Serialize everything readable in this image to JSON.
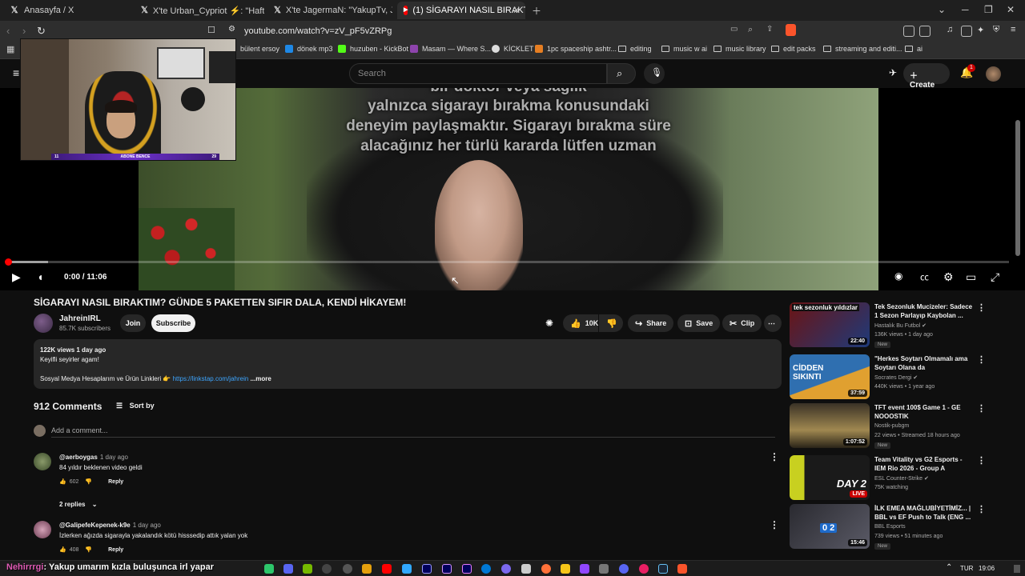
{
  "browser": {
    "tabs": [
      {
        "label": "Anasayfa / X",
        "icon": "x-logo-icon"
      },
      {
        "label": "X'te Urban_Cypriot ⚡: \"Haftaya sal",
        "icon": "x-logo-icon"
      },
      {
        "label": "X'te JagermaN: \"YakupTv, Jahrein'i te",
        "icon": "x-logo-icon"
      },
      {
        "label": "(1) SİGARAYI NASIL BIRAKTIM? G",
        "icon": "youtube-icon"
      }
    ],
    "url": "youtube.com/watch?v=zV_pF5vZRPg",
    "bookmarks": [
      {
        "label": "bülent ersoy",
        "type": "site"
      },
      {
        "label": "dönek mp3",
        "type": "site"
      },
      {
        "label": "huzuben - KickBot",
        "type": "site"
      },
      {
        "label": "Masam — Where S...",
        "type": "site"
      },
      {
        "label": "KİCKLET",
        "type": "site"
      },
      {
        "label": "1pc spaceship ashtr...",
        "type": "site"
      },
      {
        "label": "editing",
        "type": "folder"
      },
      {
        "label": "music w ai",
        "type": "folder"
      },
      {
        "label": "music library",
        "type": "folder"
      },
      {
        "label": "edit packs",
        "type": "folder"
      },
      {
        "label": "streaming and editi...",
        "type": "folder"
      },
      {
        "label": "ai",
        "type": "folder"
      }
    ]
  },
  "youtube": {
    "search_placeholder": "Search",
    "create_label": "Create",
    "notification_count": "1"
  },
  "webcam": {
    "nameplate": "ABONE BENCE",
    "left_value": "11",
    "right_value": "29"
  },
  "player": {
    "subtitle_lines": [
      "bir doktor veya sağlık",
      "yalnızca sigarayı bırakma konusundaki",
      "deneyim paylaşmaktır. Sigarayı bırakma süre",
      "alacağınız her türlü kararda lütfen uzman"
    ],
    "time": "0:00 / 11:06",
    "progress_fraction": 0.0,
    "buffer_fraction": 0.04
  },
  "video": {
    "title": "SİGARAYI NASIL BIRAKTIM? GÜNDE 5 PAKETTEN SIFIR DALA, KENDİ HİKAYEM!",
    "channel": "JahreinIRL",
    "subscribers": "85.7K subscribers",
    "join_label": "Join",
    "subscribe_label": "Subscribe",
    "likes": "10K",
    "share_label": "Share",
    "save_label": "Save",
    "clip_label": "Clip"
  },
  "description": {
    "meta": "122K views  1 day ago",
    "line1": "Keyifli seyirler agam!",
    "line2": "Sosyal Medya Hesaplarım ve Ürün Linkleri 👉",
    "link": "https://linkstap.com/jahrein",
    "more": "...more"
  },
  "comments": {
    "count": "912 Comments",
    "sort_label": "Sort by",
    "add_placeholder": "Add a comment...",
    "items": [
      {
        "user": "@aerboygas",
        "time": "1 day ago",
        "text": "84 yıldır beklenen video geldi",
        "likes": "602",
        "reply": "Reply",
        "replies": "2 replies"
      },
      {
        "user": "@GalipefeKepenek-k9e",
        "time": "1 day ago",
        "text": "İzlerken ağızda sigarayla yakalandık kötü hisssedip attık yalan yok",
        "likes": "408",
        "reply": "Reply"
      }
    ]
  },
  "recommendations": [
    {
      "title": "Tek Sezonluk Mucizeler: Sadece 1 Sezon Parlayıp Kaybolan ...",
      "channel": "Hastalık Bu Futbol",
      "meta": "136K views • 1 day ago",
      "duration": "22:40",
      "badge": "New",
      "thumb_text": "tek sezonluk yıldızlar",
      "colors": [
        "#6b1414",
        "#1e3a7a"
      ]
    },
    {
      "title": "\"Herkes Soytarı Olmamalı ama Soytarı Olana da Karışılmamalı...",
      "channel": "Socrates Dergi",
      "meta": "440K views • 1 year ago",
      "duration": "37:59",
      "badge": "",
      "thumb_text": "CİDDEN SIKINTI",
      "colors": [
        "#2f6fb0",
        "#e0a030"
      ]
    },
    {
      "title": "TFT event 100$ Game 1 - GE NOOOSTIK",
      "channel": "Nostik-pubgm",
      "meta": "22 views • Streamed 18 hours ago",
      "duration": "1:07:52",
      "badge": "New",
      "thumb_text": "",
      "colors": [
        "#5a4a2a",
        "#a08850"
      ]
    },
    {
      "title": "Team Vitality vs G2 Esports - IEM Rio 2026 - Group A",
      "channel": "ESL Counter-Strike",
      "meta": "75K watching",
      "duration": "LIVE",
      "badge": "",
      "thumb_text": "DAY 2",
      "colors": [
        "#1a1a1a",
        "#c8d020"
      ]
    },
    {
      "title": "İLK EMEA MAĞLUBİYETİMİZ... | BBL vs EF Push to Talk (ENG ...",
      "channel": "BBL Esports",
      "meta": "739 views • 51 minutes ago",
      "duration": "15:46",
      "badge": "New",
      "thumb_text": "0 2",
      "colors": [
        "#2a2a30",
        "#5a5a66"
      ]
    }
  ],
  "taskbar": {
    "ticker_name": "Nehirrrgi",
    "ticker_text": ": Yakup umarım kızla buluşunca irl yapar",
    "lang": "TUR",
    "time": "19:06"
  }
}
